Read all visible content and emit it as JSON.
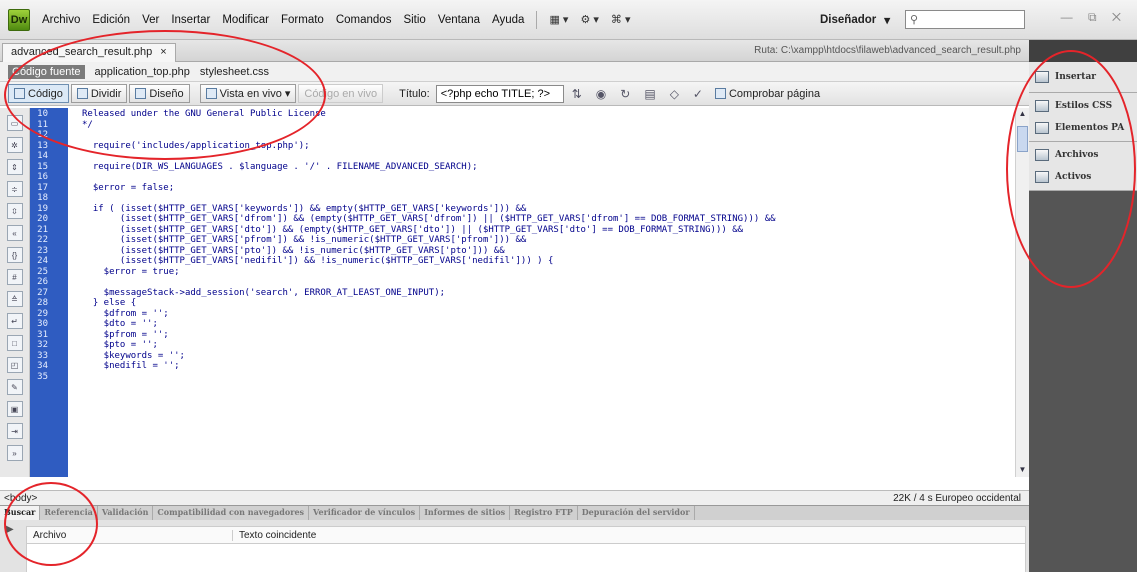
{
  "app": {
    "logo": "Dw"
  },
  "menu": [
    "Archivo",
    "Edición",
    "Ver",
    "Insertar",
    "Modificar",
    "Formato",
    "Comandos",
    "Sitio",
    "Ventana",
    "Ayuda"
  ],
  "menu_icons": {
    "layout": "▦ ▾",
    "extend": "⚙ ▾",
    "site": "⌘ ▾"
  },
  "workspace": {
    "label": "Diseñador",
    "arrow": "▾"
  },
  "search": {
    "placeholder": ""
  },
  "window_controls": "— ⧉ ✕",
  "document": {
    "tab": "advanced_search_result.php",
    "tab_close": "×",
    "path": "Ruta: C:\\xampp\\htdocs\\filaweb\\advanced_search_result.php",
    "related": [
      "Código fuente",
      "application_top.php",
      "stylesheet.css"
    ]
  },
  "toolbar": {
    "code": "Código",
    "split": "Dividir",
    "design": "Diseño",
    "live": "Vista en vivo",
    "live_code": "Código en vivo",
    "title_label": "Título:",
    "title_value": "<?php echo TITLE; ?>",
    "check_page": "Comprobar página"
  },
  "code": {
    "lines": [
      {
        "n": "10",
        "t": "Released under the GNU General Public License"
      },
      {
        "n": "11",
        "t": "*/"
      },
      {
        "n": "12",
        "t": ""
      },
      {
        "n": "13",
        "t": "  require('includes/application_top.php');"
      },
      {
        "n": "14",
        "t": ""
      },
      {
        "n": "15",
        "t": "  require(DIR_WS_LANGUAGES . $language . '/' . FILENAME_ADVANCED_SEARCH);"
      },
      {
        "n": "16",
        "t": ""
      },
      {
        "n": "17",
        "t": "  $error = false;"
      },
      {
        "n": "18",
        "t": ""
      },
      {
        "n": "19",
        "t": "  if ( (isset($HTTP_GET_VARS['keywords']) && empty($HTTP_GET_VARS['keywords'])) &&"
      },
      {
        "n": "20",
        "t": "       (isset($HTTP_GET_VARS['dfrom']) && (empty($HTTP_GET_VARS['dfrom']) || ($HTTP_GET_VARS['dfrom'] == DOB_FORMAT_STRING))) &&"
      },
      {
        "n": "21",
        "t": "       (isset($HTTP_GET_VARS['dto']) && (empty($HTTP_GET_VARS['dto']) || ($HTTP_GET_VARS['dto'] == DOB_FORMAT_STRING))) &&"
      },
      {
        "n": "22",
        "t": "       (isset($HTTP_GET_VARS['pfrom']) && !is_numeric($HTTP_GET_VARS['pfrom'])) &&"
      },
      {
        "n": "23",
        "t": "       (isset($HTTP_GET_VARS['pto']) && !is_numeric($HTTP_GET_VARS['pto'])) &&"
      },
      {
        "n": "24",
        "t": "       (isset($HTTP_GET_VARS['nedifil']) && !is_numeric($HTTP_GET_VARS['nedifil'])) ) {"
      },
      {
        "n": "25",
        "t": "    $error = true;"
      },
      {
        "n": "26",
        "t": ""
      },
      {
        "n": "27",
        "t": "    $messageStack->add_session('search', ERROR_AT_LEAST_ONE_INPUT);"
      },
      {
        "n": "28",
        "t": "  } else {"
      },
      {
        "n": "29",
        "t": "    $dfrom = '';"
      },
      {
        "n": "30",
        "t": "    $dto = '';"
      },
      {
        "n": "31",
        "t": "    $pfrom = '';"
      },
      {
        "n": "32",
        "t": "    $pto = '';"
      },
      {
        "n": "33",
        "t": "    $keywords = '';"
      },
      {
        "n": "34",
        "t": "    $nedifil = '';"
      },
      {
        "n": "35",
        "t": ""
      }
    ]
  },
  "status": {
    "tag": "<body>",
    "info": "22K / 4 s  Europeo occidental"
  },
  "results": {
    "tabs": [
      "Buscar",
      "Referencia",
      "Validación",
      "Compatibilidad con navegadores",
      "Verificador de vínculos",
      "Informes de sitios",
      "Registro FTP",
      "Depuración del servidor"
    ],
    "col_file": "Archivo",
    "col_text": "Texto coincidente"
  },
  "panel": {
    "insert": "Insertar",
    "css": "Estilos CSS",
    "ap": "Elementos PA",
    "files": "Archivos",
    "assets": "Activos"
  }
}
